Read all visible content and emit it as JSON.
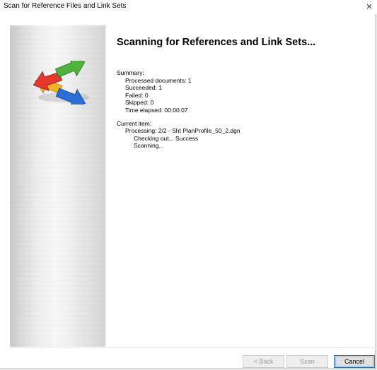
{
  "window": {
    "title": "Scan for Reference Files and Link Sets",
    "close_glyph": "×"
  },
  "sidebar": {
    "logo_icon": "four-way-arrows-icon",
    "colors": {
      "red": "#e8372c",
      "green": "#4cb43a",
      "blue": "#2a6fd6",
      "yellow": "#f3b422"
    }
  },
  "main": {
    "heading": "Scanning for References and Link Sets...",
    "summary_label": "Summary:",
    "processed": "Processed documents: 1",
    "succeeded": "Succeeded: 1",
    "failed": "Failed: 0",
    "skipped": "Skipped: 0",
    "elapsed": "Time elapsed: 00:00:07",
    "current_label": "Current item:",
    "processing": "Processing: 2/2 - Sht PlanProfile_50_2.dgn",
    "checking": "Checking out... Success",
    "scanning": "Scanning..."
  },
  "buttons": {
    "back": "< Back",
    "scan": "Scan",
    "cancel": "Cancel"
  }
}
